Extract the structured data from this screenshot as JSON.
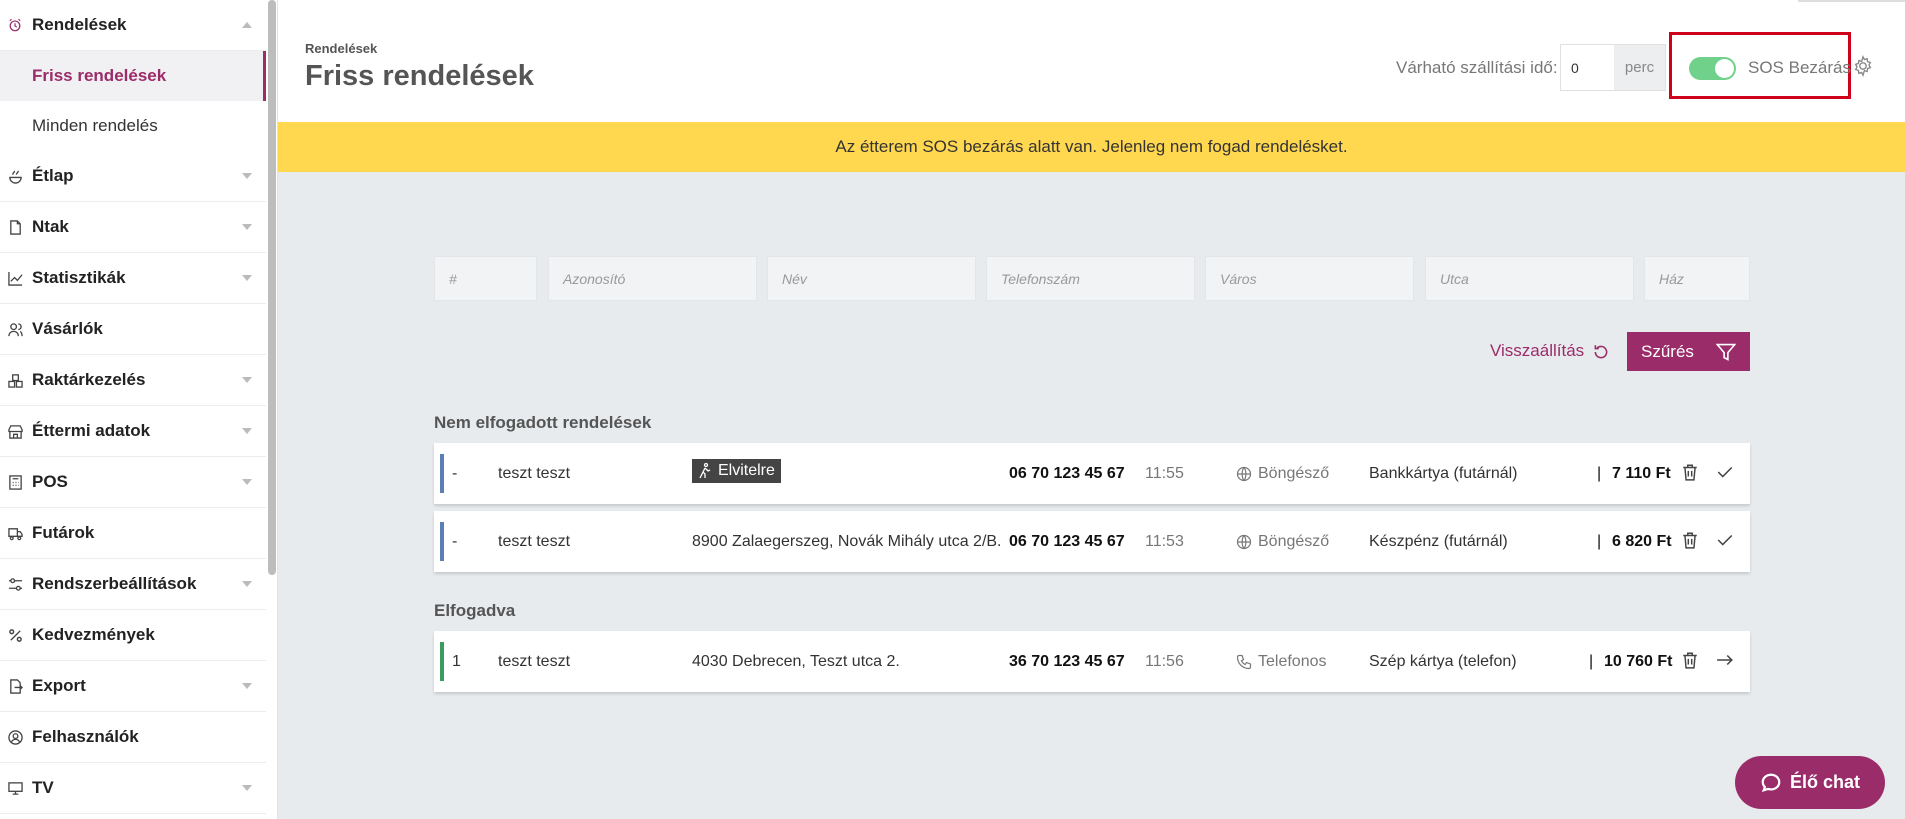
{
  "sidebar": {
    "items": [
      {
        "label": "Rendelések",
        "icon": "alarm-clock-icon",
        "expanded": true,
        "subitems": [
          {
            "label": "Friss rendelések",
            "active": true
          },
          {
            "label": "Minden rendelés",
            "active": false
          }
        ]
      },
      {
        "label": "Étlap",
        "icon": "dish-icon"
      },
      {
        "label": "Ntak",
        "icon": "document-icon"
      },
      {
        "label": "Statisztikák",
        "icon": "chart-icon"
      },
      {
        "label": "Vásárlók",
        "icon": "users-icon"
      },
      {
        "label": "Raktárkezelés",
        "icon": "boxes-icon"
      },
      {
        "label": "Éttermi adatok",
        "icon": "store-icon"
      },
      {
        "label": "POS",
        "icon": "calculator-icon"
      },
      {
        "label": "Futárok",
        "icon": "truck-icon"
      },
      {
        "label": "Rendszerbeállítások",
        "icon": "sliders-icon"
      },
      {
        "label": "Kedvezmények",
        "icon": "percent-icon"
      },
      {
        "label": "Export",
        "icon": "export-icon"
      },
      {
        "label": "Felhasználók",
        "icon": "user-circle-icon"
      },
      {
        "label": "TV",
        "icon": "monitor-icon"
      }
    ]
  },
  "header": {
    "breadcrumb": "Rendelések",
    "title": "Friss rendelések",
    "eta_label": "Várható szállítási idő:",
    "eta_value": "0",
    "eta_unit": "perc",
    "sos_label": "SOS Bezárás",
    "sos_enabled": true
  },
  "banner": {
    "text": "Az étterem SOS bezárás alatt van. Jelenleg nem fogad rendelésket."
  },
  "filters": {
    "placeholders": [
      "#",
      "Azonosító",
      "Név",
      "Telefonszám",
      "Város",
      "Utca",
      "Ház"
    ],
    "reset_label": "Visszaállítás",
    "filter_label": "Szűrés"
  },
  "sections": {
    "pending": {
      "title": "Nem elfogadott rendelések",
      "orders": [
        {
          "num": "-",
          "name": "teszt teszt",
          "tag": "Elvitelre",
          "phone": "06 70 123 45 67",
          "time": "11:55",
          "source": "Böngésző",
          "payment": "Bankkártya (futárnál)",
          "price": "7 110 Ft"
        },
        {
          "num": "-",
          "name": "teszt teszt",
          "address": "8900 Zalaegerszeg, Novák Mihály utca 2/B.",
          "phone": "06 70 123 45 67",
          "time": "11:53",
          "source": "Böngésző",
          "payment": "Készpénz (futárnál)",
          "price": "6 820 Ft"
        }
      ]
    },
    "accepted": {
      "title": "Elfogadva",
      "orders": [
        {
          "num": "1",
          "name": "teszt teszt",
          "address": "4030 Debrecen, Teszt utca 2.",
          "phone": "36 70 123 45 67",
          "time": "11:56",
          "source": "Telefonos",
          "payment": "Szép kártya (telefon)",
          "price": "10 760 Ft"
        }
      ]
    }
  },
  "chat": {
    "label": "Élő chat"
  },
  "colors": {
    "brand": "#9b2c6a",
    "banner": "#ffd84f",
    "toggle_on": "#6fd18a",
    "pending_bar": "#5b7fb5",
    "accepted_bar": "#3a9d5d"
  }
}
